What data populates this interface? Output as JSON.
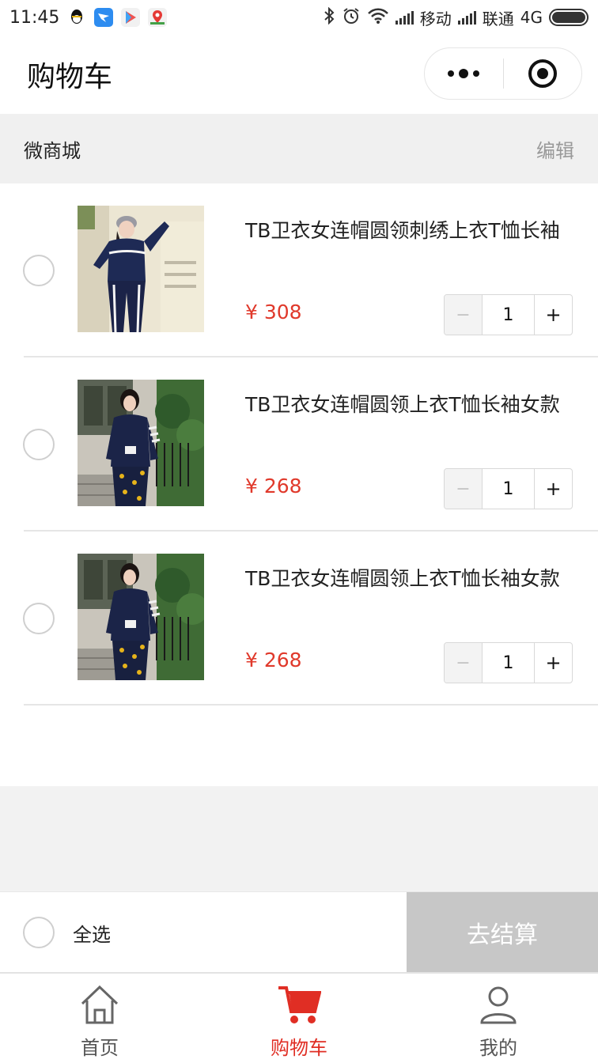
{
  "status_bar": {
    "time": "11:45",
    "carrier1": "移动",
    "carrier2": "联通",
    "network": "4G",
    "icons": [
      "qq-icon",
      "dingtalk-icon",
      "play-store-icon",
      "maps-icon",
      "bluetooth-icon",
      "alarm-icon",
      "wifi-icon",
      "signal-icon",
      "battery-icon"
    ]
  },
  "nav": {
    "title": "购物车",
    "capsule_icons": [
      "more-icon",
      "close-target-icon"
    ]
  },
  "shop": {
    "name": "微商城",
    "edit_label": "编辑"
  },
  "items": [
    {
      "title": "TB卫衣女连帽圆领刺绣上衣T恤长袖",
      "price": "¥ 308",
      "minus": "−",
      "qty": "1",
      "plus": "+",
      "selected": false
    },
    {
      "title": "TB卫衣女连帽圆领上衣T恤长袖女款",
      "price": "¥ 268",
      "minus": "−",
      "qty": "1",
      "plus": "+",
      "selected": false
    },
    {
      "title": "TB卫衣女连帽圆领上衣T恤长袖女款",
      "price": "¥ 268",
      "minus": "−",
      "qty": "1",
      "plus": "+",
      "selected": false
    }
  ],
  "checkout": {
    "select_all_label": "全选",
    "button_label": "去结算"
  },
  "tabs": [
    {
      "label": "首页",
      "icon": "home-icon",
      "active": false
    },
    {
      "label": "购物车",
      "icon": "cart-icon",
      "active": true
    },
    {
      "label": "我的",
      "icon": "user-icon",
      "active": false
    }
  ],
  "colors": {
    "price": "#e0392b",
    "active_tab": "#e02e24",
    "checkout_disabled": "#c7c7c7"
  }
}
